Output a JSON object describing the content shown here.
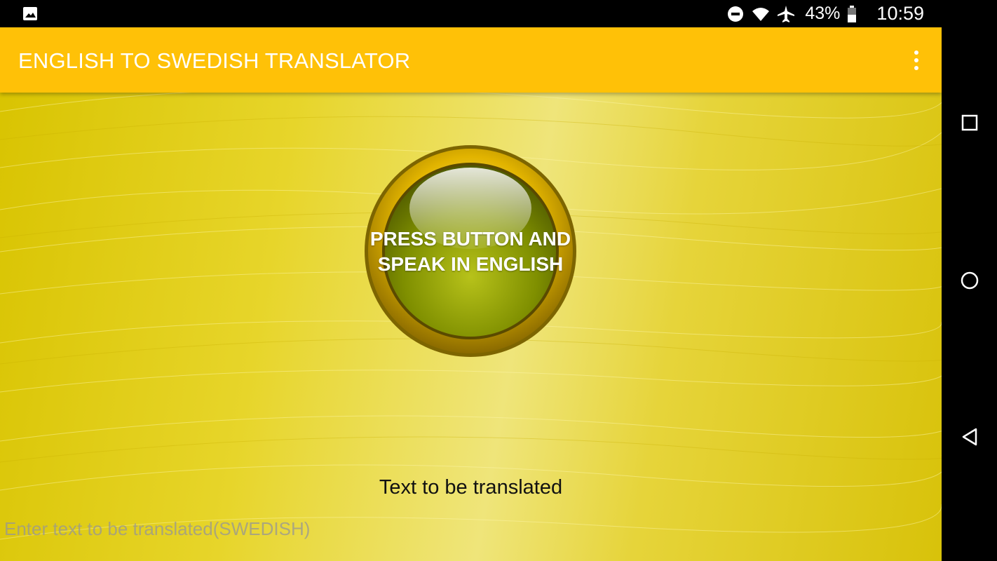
{
  "status_bar": {
    "battery": "43%",
    "time": "10:59",
    "icons": [
      "image-icon",
      "do-not-disturb-icon",
      "wifi-icon",
      "airplane-icon",
      "battery-icon"
    ]
  },
  "toolbar": {
    "title": "ENGLISH TO SWEDISH TRANSLATOR",
    "menu_icon": "more-vert-icon"
  },
  "main": {
    "speak_button_label": "PRESS BUTTON AND SPEAK IN ENGLISH",
    "text_label": "Text to be translated",
    "input": {
      "value": "",
      "placeholder": "Enter text to be translated(SWEDISH)"
    }
  },
  "nav_bar": {
    "buttons": [
      "recents-icon",
      "home-icon",
      "back-icon"
    ]
  },
  "colors": {
    "toolbar": "#ffc107",
    "background": "#e6d43a",
    "button_center": "#7a8a00",
    "button_ring": "#d8aa00"
  }
}
